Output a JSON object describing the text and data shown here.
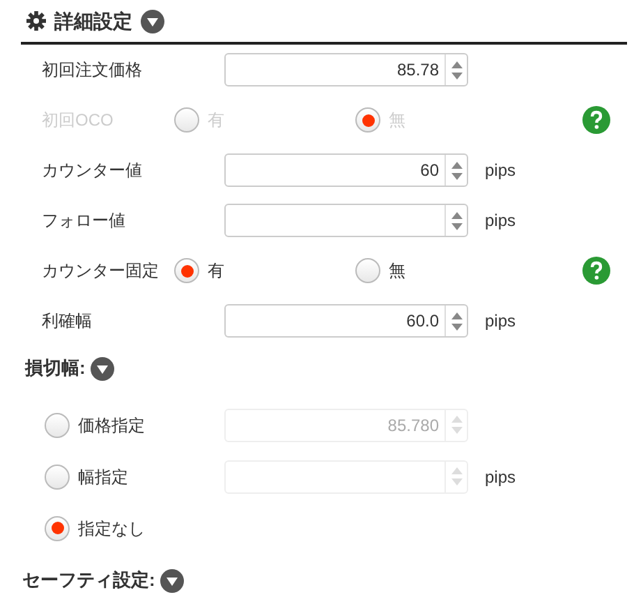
{
  "header": {
    "title": "詳細設定"
  },
  "rows": [
    {
      "kind": "number",
      "label": "初回注文価格",
      "value": "85.78"
    },
    {
      "kind": "radio",
      "label": "初回OCO",
      "disabled": true,
      "help": true,
      "options": [
        {
          "label": "有",
          "selected": false
        },
        {
          "label": "無",
          "selected": true
        }
      ]
    },
    {
      "kind": "number",
      "label": "カウンター値",
      "value": "60",
      "unit": "pips"
    },
    {
      "kind": "number",
      "label": "フォロー値",
      "unit": "pips"
    },
    {
      "kind": "radio",
      "label": "カウンター固定",
      "help": true,
      "options": [
        {
          "label": "有",
          "selected": true
        },
        {
          "label": "無",
          "selected": false
        }
      ]
    },
    {
      "kind": "number",
      "label": "利確幅",
      "value": "60.0",
      "unit": "pips"
    }
  ],
  "stop_loss": {
    "title": "損切幅:",
    "options": [
      {
        "label": "価格指定",
        "selected": false,
        "field": {
          "value": "85.780",
          "disabled": true
        }
      },
      {
        "label": "幅指定",
        "selected": false,
        "field": {
          "unit": "pips",
          "disabled": true
        }
      },
      {
        "label": "指定なし",
        "selected": true
      }
    ]
  },
  "safety": {
    "title": "セーフティ設定:"
  }
}
